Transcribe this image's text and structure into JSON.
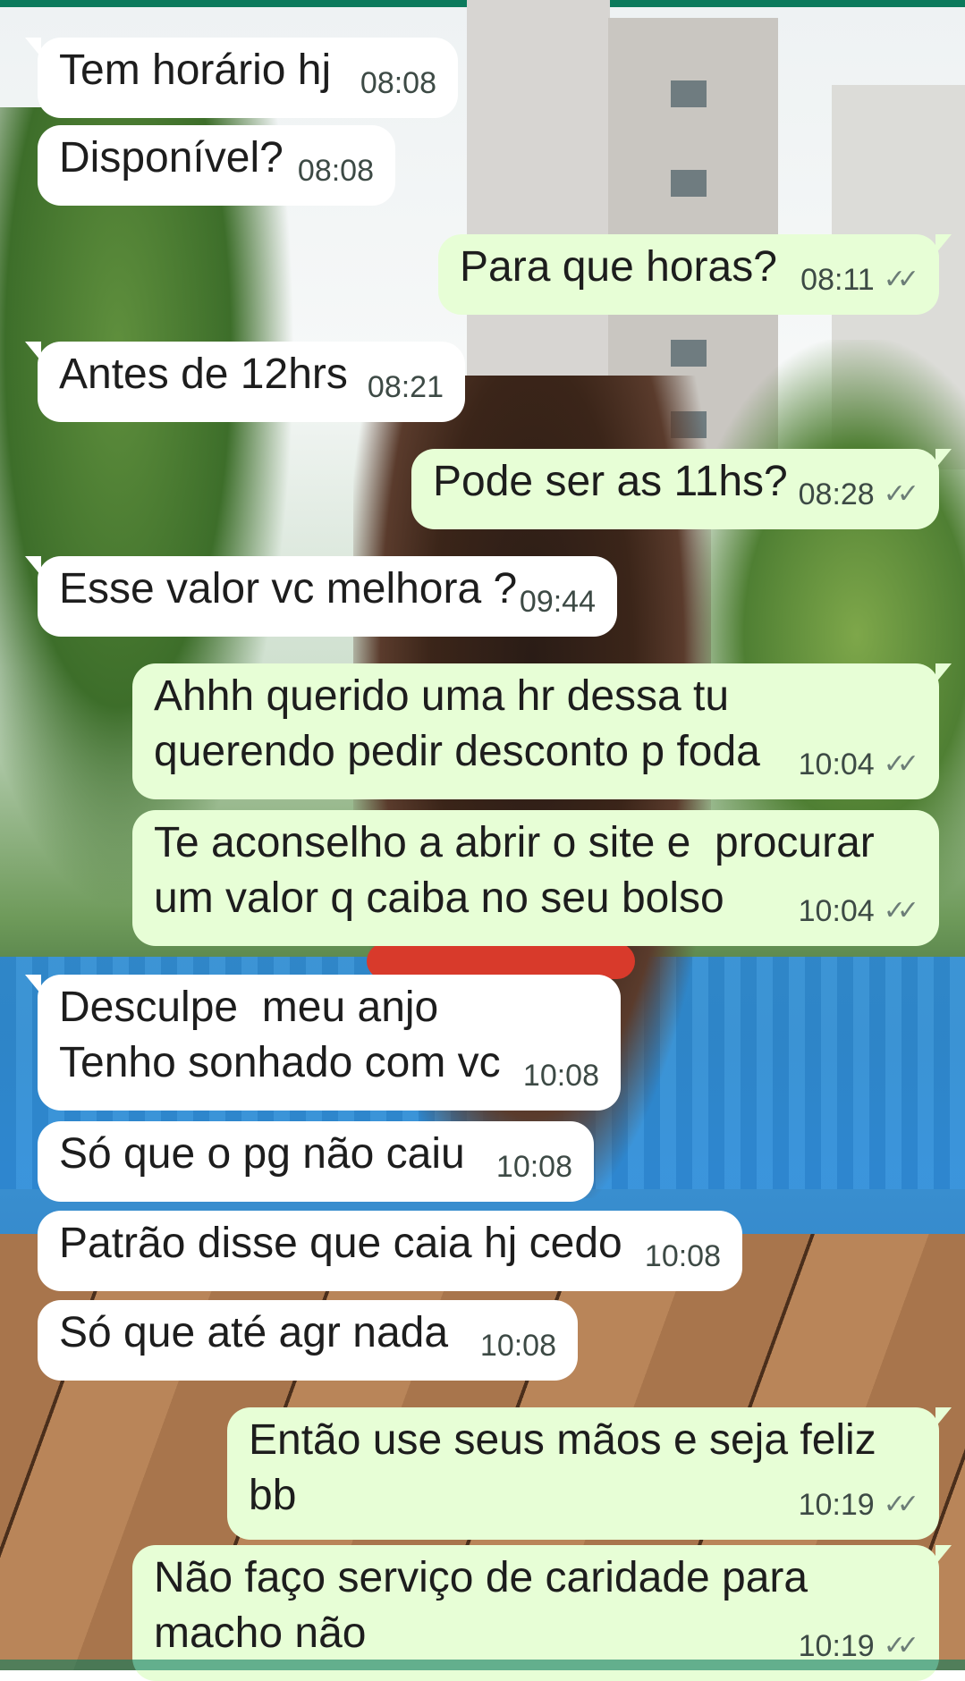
{
  "messages": [
    {
      "direction": "in",
      "text": "Tem horário hj",
      "time": "08:08"
    },
    {
      "direction": "in",
      "text": "Disponível?",
      "time": "08:08"
    },
    {
      "direction": "out",
      "text": "Para que horas?",
      "time": "08:11",
      "status": "read-checkmarks"
    },
    {
      "direction": "in",
      "text": "Antes de 12hrs",
      "time": "08:21"
    },
    {
      "direction": "out",
      "text": "Pode ser as 11hs?",
      "time": "08:28",
      "status": "read-checkmarks"
    },
    {
      "direction": "in",
      "text": "Esse valor vc melhora ?",
      "time": "09:44"
    },
    {
      "direction": "out",
      "text": "Ahhh querido uma hr dessa tu\nquerendo pedir desconto p foda",
      "time": "10:04",
      "status": "read-checkmarks"
    },
    {
      "direction": "out",
      "text": "Te aconselho a abrir o site e  procurar\num valor q caiba no seu bolso",
      "time": "10:04",
      "status": "read-checkmarks"
    },
    {
      "direction": "in",
      "text": "Desculpe  meu anjo\nTenho sonhado com vc",
      "time": "10:08"
    },
    {
      "direction": "in",
      "text": "Só que o pg não caiu",
      "time": "10:08"
    },
    {
      "direction": "in",
      "text": "Patrão disse que caia hj cedo",
      "time": "10:08"
    },
    {
      "direction": "in",
      "text": "Só que até agr nada",
      "time": "10:08"
    },
    {
      "direction": "out",
      "text": "Então use seus mãos e seja feliz bb",
      "time": "10:19",
      "status": "read-checkmarks"
    },
    {
      "direction": "out",
      "text": "Não faço serviço de caridade para\nmacho não",
      "time": "10:19",
      "status": "read-checkmarks"
    }
  ],
  "colors": {
    "incoming_bubble": "#ffffff",
    "outgoing_bubble": "#e7fed6",
    "app_accent": "#0b7a5c"
  },
  "checkmark_glyph": "✓✓"
}
